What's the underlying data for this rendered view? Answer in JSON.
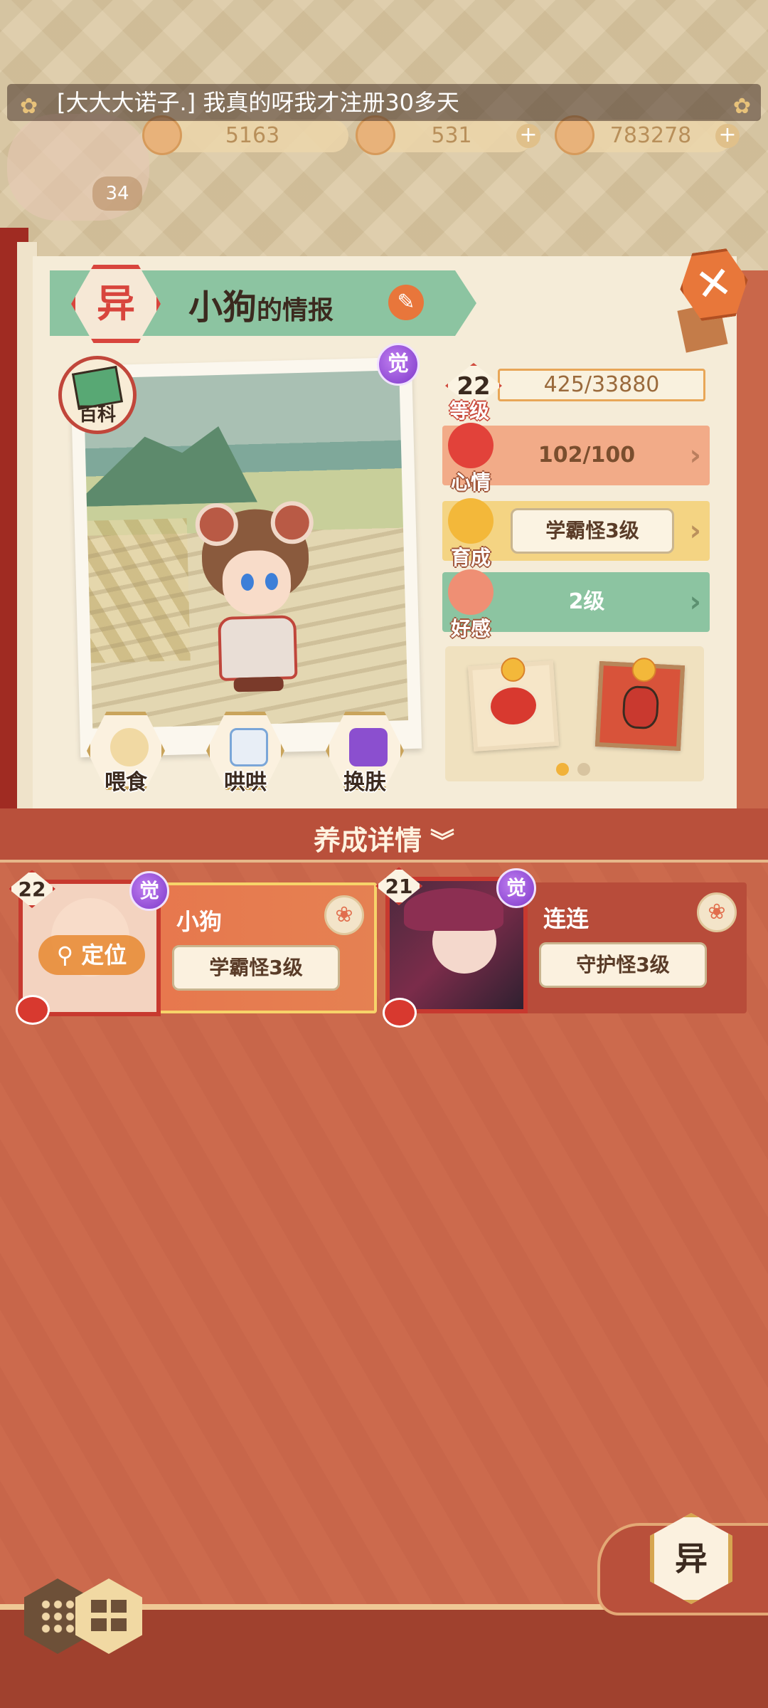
{
  "top": {
    "marquee_text": "[大大大诺子.] 我真的呀我才注册30多天",
    "resources": [
      {
        "name": "flower-currency",
        "value": "5163"
      },
      {
        "name": "candy-currency",
        "value": "531"
      },
      {
        "name": "coin-currency",
        "value": "783278"
      }
    ],
    "player_level": "34"
  },
  "panel": {
    "title_badge": "异",
    "title_name": "小狗",
    "title_suffix": "的情报",
    "baike_label": "百科",
    "awaken_label": "觉",
    "level": {
      "value": "22",
      "label": "等级",
      "exp": "425/33880"
    },
    "mood": {
      "label": "心情",
      "value": "102/100"
    },
    "growth": {
      "label": "育成",
      "value": "学霸怪3级"
    },
    "affection": {
      "label": "好感",
      "value": "2级"
    },
    "actions": [
      {
        "label": "喂食"
      },
      {
        "label": "哄哄"
      },
      {
        "label": "换肤"
      }
    ]
  },
  "section": {
    "title": "养成详情",
    "chevron": "⌄"
  },
  "pets": [
    {
      "level": "22",
      "awaken": "觉",
      "name": "小狗",
      "title": "学霸怪3级",
      "locate": "定位"
    },
    {
      "level": "21",
      "awaken": "觉",
      "name": "连连",
      "title": "守护怪3级"
    }
  ],
  "bottom": {
    "yi_button": "异"
  },
  "colors": {
    "accent_red": "#c9392f",
    "panel_bg": "#f5ecd8",
    "bottom_bg": "#c9674a",
    "awaken_purple": "#7d38c9"
  },
  "icons": [
    "flower-icon",
    "close-icon",
    "edit-icon",
    "baike-book-icon",
    "feed-bowl-icon",
    "milk-icon",
    "skin-icon",
    "heart-icon",
    "smile-icon",
    "double-chevron-down-icon",
    "grid-view-icon",
    "list-view-icon"
  ]
}
